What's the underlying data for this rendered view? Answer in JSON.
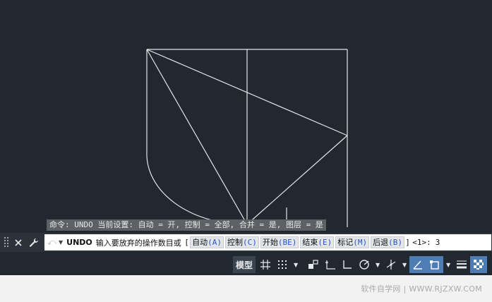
{
  "history": {
    "text": "命令: UNDO 当前设置: 自动 = 开, 控制 = 全部, 合并 = 是, 图层 = 是"
  },
  "command": {
    "name": "UNDO",
    "prompt": "输入要放弃的操作数目或",
    "open_bracket": "[",
    "close_bracket": "]",
    "options": [
      {
        "label": "自动",
        "key": "(A)"
      },
      {
        "label": "控制",
        "key": "(C)"
      },
      {
        "label": "开始",
        "key": "(BE)"
      },
      {
        "label": "结束",
        "key": "(E)"
      },
      {
        "label": "标记",
        "key": "(M)"
      },
      {
        "label": "后退",
        "key": "(B)"
      }
    ],
    "default": "<1>:",
    "input_value": "3"
  },
  "statusbar": {
    "model_label": "模型"
  },
  "watermark": {
    "text": "软件自学网 | WWW.RJZXW.COM"
  },
  "colors": {
    "canvas": "#212830",
    "lines": "#e6e6e6",
    "toggle_on": "#4d7db3",
    "option_key": "#2857c8"
  }
}
